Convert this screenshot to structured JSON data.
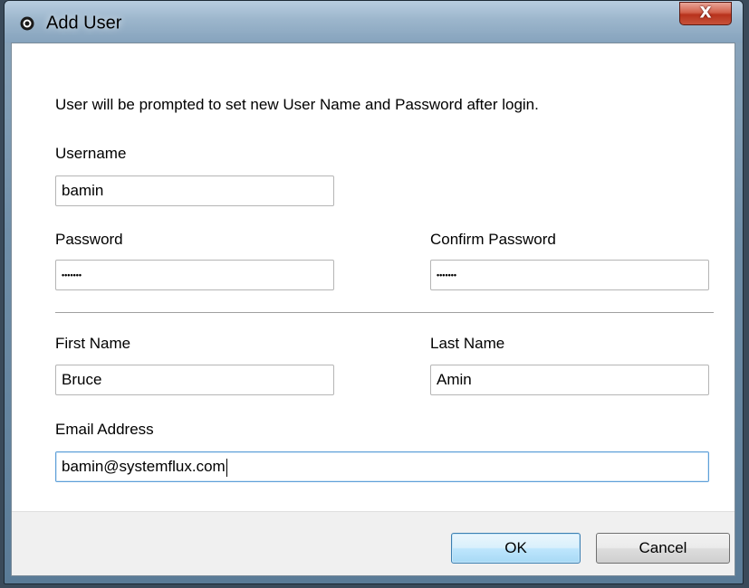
{
  "window": {
    "title": "Add User",
    "close_label": "X"
  },
  "info_text": "User will be prompted to set new User Name and Password after login.",
  "fields": {
    "username": {
      "label": "Username",
      "value": "bamin"
    },
    "password": {
      "label": "Password",
      "value": "•••••••"
    },
    "confirm_password": {
      "label": "Confirm Password",
      "value": "•••••••"
    },
    "first_name": {
      "label": "First Name",
      "value": "Bruce"
    },
    "last_name": {
      "label": "Last Name",
      "value": "Amin"
    },
    "email": {
      "label": "Email Address",
      "value": "bamin@systemflux.com"
    }
  },
  "buttons": {
    "ok": "OK",
    "cancel": "Cancel"
  },
  "colors": {
    "focus_border": "#5fa0d8",
    "default_button_border": "#3c7fb1",
    "close_button": "#c6523a"
  },
  "icons": {
    "title": "app-gear-icon",
    "close": "close-icon"
  }
}
